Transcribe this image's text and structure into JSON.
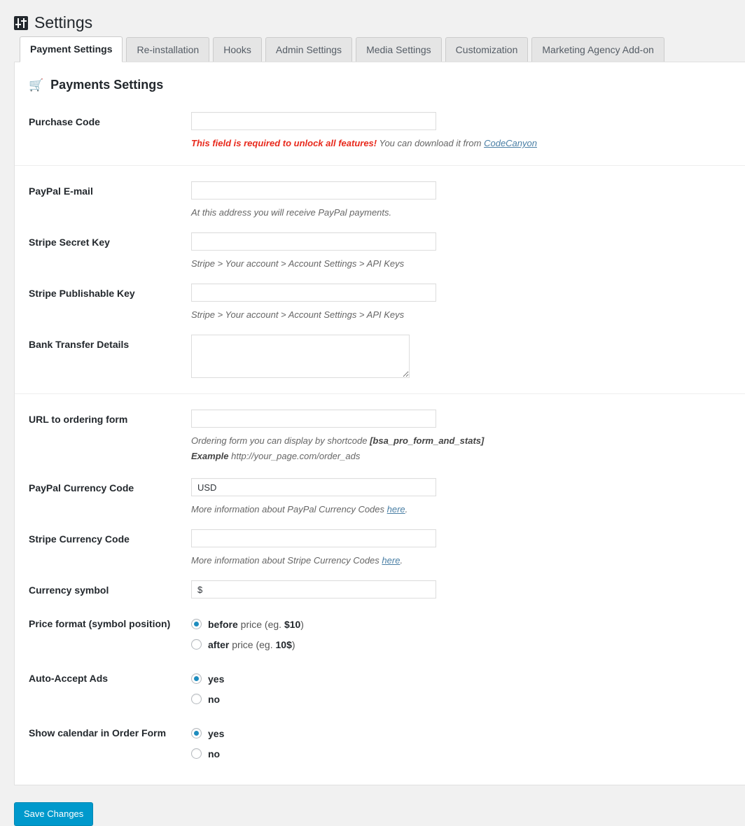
{
  "header": {
    "title": "Settings",
    "icon": "sliders-settings-icon"
  },
  "tabs": [
    {
      "label": "Payment Settings",
      "active": true
    },
    {
      "label": "Re-installation",
      "active": false
    },
    {
      "label": "Hooks",
      "active": false
    },
    {
      "label": "Admin Settings",
      "active": false
    },
    {
      "label": "Media Settings",
      "active": false
    },
    {
      "label": "Customization",
      "active": false
    },
    {
      "label": "Marketing Agency Add-on",
      "active": false
    }
  ],
  "section": {
    "icon": "shopping-cart-icon",
    "title": "Payments Settings"
  },
  "fields": {
    "purchase_code": {
      "label": "Purchase Code",
      "value": "",
      "hint_error": "This field is required to unlock all features!",
      "hint_text": " You can download it from ",
      "hint_link": "CodeCanyon"
    },
    "paypal_email": {
      "label": "PayPal E-mail",
      "value": "",
      "hint": "At this address you will receive PayPal payments."
    },
    "stripe_secret_key": {
      "label": "Stripe Secret Key",
      "value": "",
      "hint": "Stripe > Your account > Account Settings > API Keys"
    },
    "stripe_publishable_key": {
      "label": "Stripe Publishable Key",
      "value": "",
      "hint": "Stripe > Your account > Account Settings > API Keys"
    },
    "bank_transfer_details": {
      "label": "Bank Transfer Details",
      "value": ""
    },
    "url_ordering_form": {
      "label": "URL to ordering form",
      "value": "",
      "hint_prefix": "Ordering form you can display by shortcode ",
      "hint_shortcode": "[bsa_pro_form_and_stats]",
      "example_label": "Example",
      "example_value": " http://your_page.com/order_ads"
    },
    "paypal_currency_code": {
      "label": "PayPal Currency Code",
      "value": "USD",
      "hint_prefix": "More information about PayPal Currency Codes ",
      "hint_link": "here",
      "hint_suffix": "."
    },
    "stripe_currency_code": {
      "label": "Stripe Currency Code",
      "value": "",
      "hint_prefix": "More information about Stripe Currency Codes ",
      "hint_link": "here",
      "hint_suffix": "."
    },
    "currency_symbol": {
      "label": "Currency symbol",
      "value": "$"
    },
    "price_format": {
      "label": "Price format (symbol position)",
      "options": [
        {
          "strong": "before",
          "rest": " price (eg. ",
          "bold": "$10",
          "tail": ")",
          "selected": true
        },
        {
          "strong": "after",
          "rest": " price (eg. ",
          "bold": "10$",
          "tail": ")",
          "selected": false
        }
      ]
    },
    "auto_accept_ads": {
      "label": "Auto-Accept Ads",
      "options": [
        {
          "strong": "yes",
          "rest": "",
          "bold": "",
          "tail": "",
          "selected": true
        },
        {
          "strong": "no",
          "rest": "",
          "bold": "",
          "tail": "",
          "selected": false
        }
      ]
    },
    "show_calendar": {
      "label": "Show calendar in Order Form",
      "options": [
        {
          "strong": "yes",
          "rest": "",
          "bold": "",
          "tail": "",
          "selected": true
        },
        {
          "strong": "no",
          "rest": "",
          "bold": "",
          "tail": "",
          "selected": false
        }
      ]
    }
  },
  "footer": {
    "save_label": "Save Changes"
  },
  "colors": {
    "accent": "#0099cc",
    "radio_selected": "#1e8cbe",
    "error": "#e8291c",
    "link": "#4a7fa5",
    "page_bg": "#f1f1f1"
  }
}
